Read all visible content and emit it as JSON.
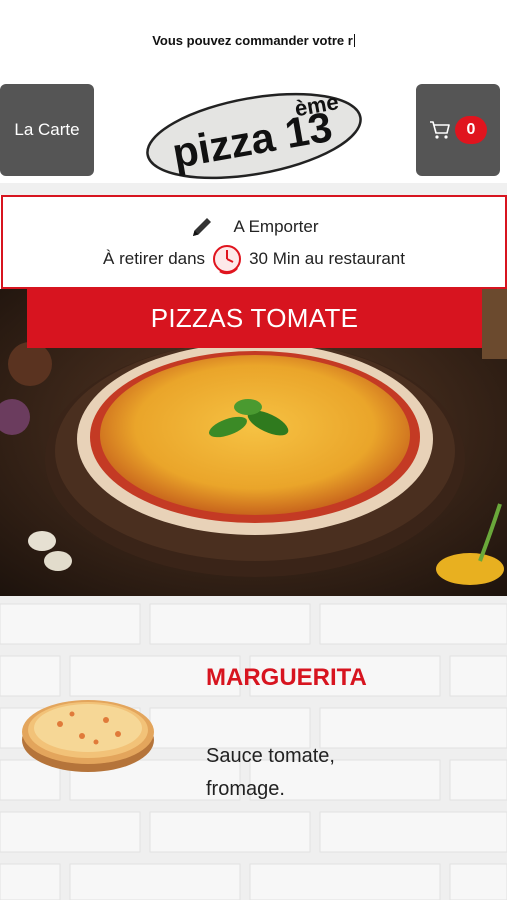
{
  "header": {
    "marquee_text": "Vous pouvez commander votre r",
    "menu_button_label": "La Carte",
    "cart_count": "0",
    "logo_text_main": "pizza 13",
    "logo_text_sup": "ème"
  },
  "order_mode": {
    "mode_label": "A Emporter",
    "pickup_prefix": "À retirer dans",
    "pickup_suffix": "30 Min au restaurant"
  },
  "category": {
    "title": "PIZZAS TOMATE"
  },
  "products": [
    {
      "name": "MARGUERITA",
      "description": "Sauce tomate, fromage."
    }
  ],
  "colors": {
    "accent_red": "#d7141f",
    "button_gray": "#555555",
    "badge_red": "#e0141e"
  },
  "icons": {
    "pencil": "pencil-icon",
    "clock": "clock-icon",
    "cart": "cart-icon"
  }
}
